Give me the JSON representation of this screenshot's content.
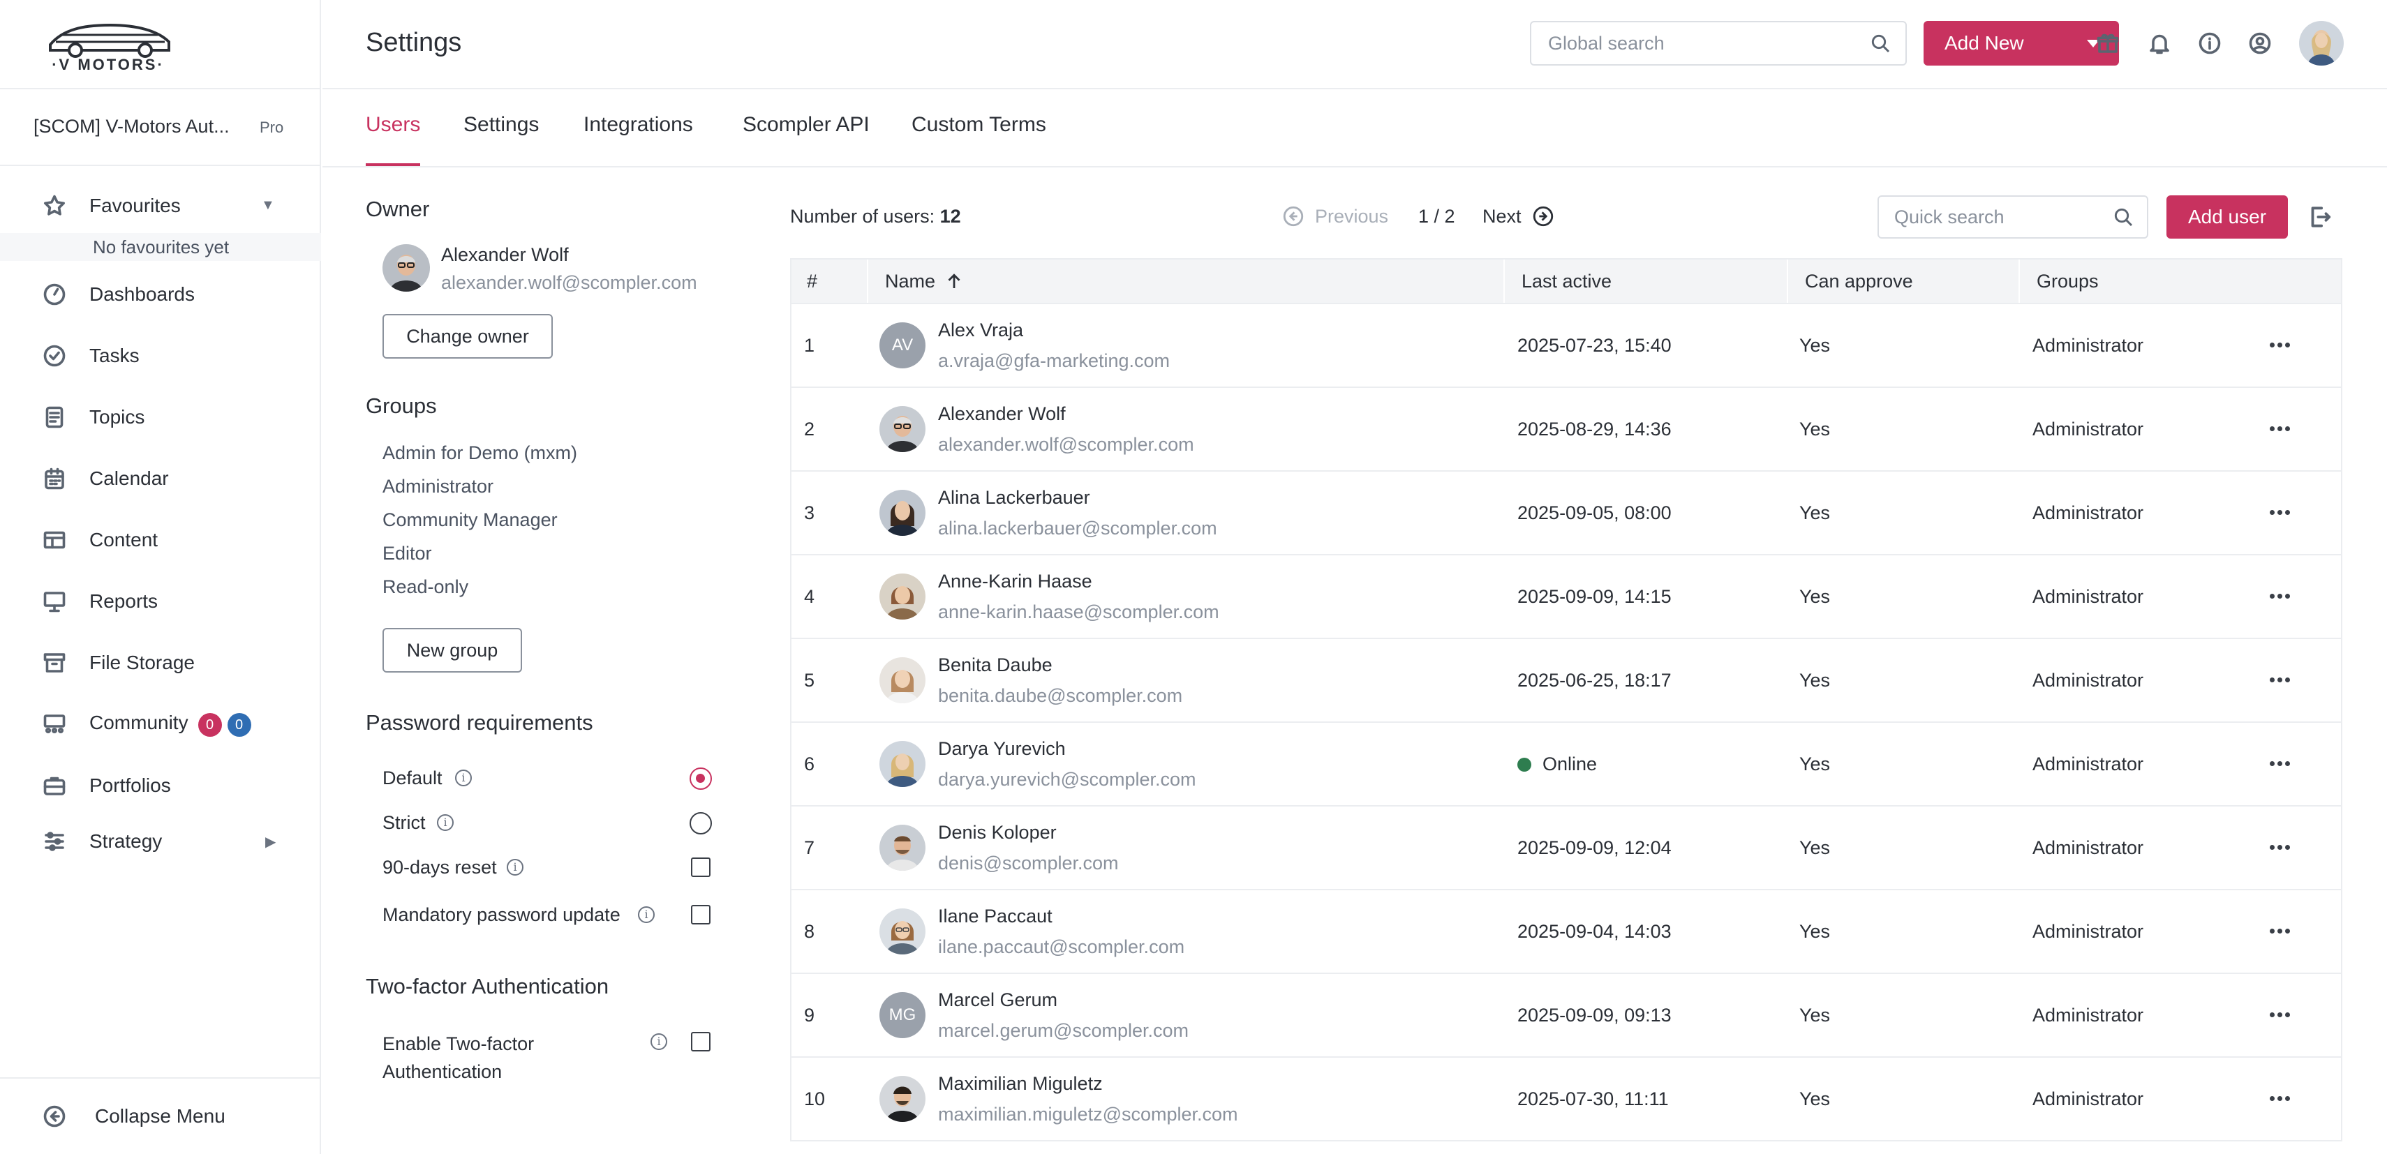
{
  "brand": {
    "logo_text": "·V MOTORS·"
  },
  "workspace": {
    "name": "[SCOM] V-Motors Aut...",
    "plan": "Pro"
  },
  "sidebar": {
    "favourites_label": "Favourites",
    "no_favourites": "No favourites yet",
    "items": [
      {
        "label": "Dashboards",
        "icon": "dashboard-icon"
      },
      {
        "label": "Tasks",
        "icon": "check-circle-icon"
      },
      {
        "label": "Topics",
        "icon": "document-icon"
      },
      {
        "label": "Calendar",
        "icon": "calendar-icon"
      },
      {
        "label": "Content",
        "icon": "table-icon"
      },
      {
        "label": "Reports",
        "icon": "monitor-icon"
      },
      {
        "label": "File Storage",
        "icon": "archive-icon"
      },
      {
        "label": "Community",
        "icon": "community-icon"
      },
      {
        "label": "Portfolios",
        "icon": "briefcase-icon"
      },
      {
        "label": "Strategy",
        "icon": "sliders-icon"
      }
    ],
    "community_badges": [
      {
        "value": "0",
        "color": "#c8325f"
      },
      {
        "value": "0",
        "color": "#2f6db3"
      }
    ],
    "collapse_label": "Collapse Menu"
  },
  "header": {
    "title": "Settings",
    "search_placeholder": "Global search",
    "add_new_label": "Add New"
  },
  "tabs": [
    {
      "label": "Users",
      "active": true
    },
    {
      "label": "Settings",
      "active": false
    },
    {
      "label": "Integrations",
      "active": false
    },
    {
      "label": "Scompler API",
      "active": false
    },
    {
      "label": "Custom Terms",
      "active": false
    }
  ],
  "owner": {
    "title": "Owner",
    "name": "Alexander Wolf",
    "email": "alexander.wolf@scompler.com",
    "change_label": "Change owner"
  },
  "groups": {
    "title": "Groups",
    "items": [
      "Admin for Demo (mxm)",
      "Administrator",
      "Community Manager",
      "Editor",
      "Read-only"
    ],
    "new_label": "New group"
  },
  "password": {
    "title": "Password requirements",
    "options": [
      {
        "label": "Default",
        "type": "radio",
        "checked": true
      },
      {
        "label": "Strict",
        "type": "radio",
        "checked": false
      },
      {
        "label": "90-days reset",
        "type": "checkbox",
        "checked": false
      },
      {
        "label": "Mandatory password update",
        "type": "checkbox",
        "checked": false
      }
    ]
  },
  "twofa": {
    "title": "Two-factor Authentication",
    "line1": "Enable Two-factor",
    "line2": "Authentication",
    "checked": false
  },
  "users": {
    "count_label": "Number of users:",
    "count": "12",
    "prev_label": "Previous",
    "page": "1 / 2",
    "next_label": "Next",
    "quick_search_placeholder": "Quick search",
    "add_user_label": "Add user",
    "columns": [
      "#",
      "Name",
      "Last active",
      "Can approve",
      "Groups"
    ],
    "rows": [
      {
        "n": "1",
        "name": "Alex Vraja",
        "email": "a.vraja@gfa-marketing.com",
        "last": "2025-07-23, 15:40",
        "approve": "Yes",
        "group": "Administrator",
        "initials": "AV"
      },
      {
        "n": "2",
        "name": "Alexander Wolf",
        "email": "alexander.wolf@scompler.com",
        "last": "2025-08-29, 14:36",
        "approve": "Yes",
        "group": "Administrator",
        "initials": ""
      },
      {
        "n": "3",
        "name": "Alina Lackerbauer",
        "email": "alina.lackerbauer@scompler.com",
        "last": "2025-09-05, 08:00",
        "approve": "Yes",
        "group": "Administrator",
        "initials": ""
      },
      {
        "n": "4",
        "name": "Anne-Karin Haase",
        "email": "anne-karin.haase@scompler.com",
        "last": "2025-09-09, 14:15",
        "approve": "Yes",
        "group": "Administrator",
        "initials": ""
      },
      {
        "n": "5",
        "name": "Benita Daube",
        "email": "benita.daube@scompler.com",
        "last": "2025-06-25, 18:17",
        "approve": "Yes",
        "group": "Administrator",
        "initials": ""
      },
      {
        "n": "6",
        "name": "Darya Yurevich",
        "email": "darya.yurevich@scompler.com",
        "last": "Online",
        "approve": "Yes",
        "group": "Administrator",
        "initials": ""
      },
      {
        "n": "7",
        "name": "Denis Koloper",
        "email": "denis@scompler.com",
        "last": "2025-09-09, 12:04",
        "approve": "Yes",
        "group": "Administrator",
        "initials": ""
      },
      {
        "n": "8",
        "name": "Ilane Paccaut",
        "email": "ilane.paccaut@scompler.com",
        "last": "2025-09-04, 14:03",
        "approve": "Yes",
        "group": "Administrator",
        "initials": ""
      },
      {
        "n": "9",
        "name": "Marcel Gerum",
        "email": "marcel.gerum@scompler.com",
        "last": "2025-09-09, 09:13",
        "approve": "Yes",
        "group": "Administrator",
        "initials": "MG"
      },
      {
        "n": "10",
        "name": "Maximilian Miguletz",
        "email": "maximilian.miguletz@scompler.com",
        "last": "2025-07-30, 11:11",
        "approve": "Yes",
        "group": "Administrator",
        "initials": ""
      }
    ]
  },
  "colors": {
    "accent": "#c8325f",
    "online": "#2e7d4f",
    "border": "#ebedf0"
  }
}
